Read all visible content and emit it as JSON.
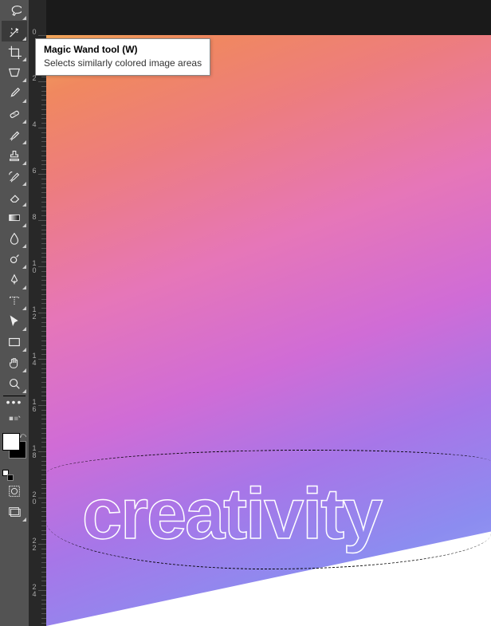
{
  "tooltip": {
    "title": "Magic Wand tool (W)",
    "description": "Selects similarly colored image areas"
  },
  "canvas": {
    "text": "creativity"
  },
  "tools": [
    {
      "name": "lasso-tool",
      "icon": "lasso"
    },
    {
      "name": "magic-wand-tool",
      "icon": "wand",
      "active": true
    },
    {
      "name": "crop-tool",
      "icon": "crop"
    },
    {
      "name": "frame-tool",
      "icon": "frame"
    },
    {
      "name": "eyedropper-tool",
      "icon": "eyedropper"
    },
    {
      "name": "healing-brush-tool",
      "icon": "bandage"
    },
    {
      "name": "brush-tool",
      "icon": "brush"
    },
    {
      "name": "clone-stamp-tool",
      "icon": "stamp"
    },
    {
      "name": "history-brush-tool",
      "icon": "history-brush"
    },
    {
      "name": "eraser-tool",
      "icon": "eraser"
    },
    {
      "name": "gradient-tool",
      "icon": "gradient"
    },
    {
      "name": "blur-tool",
      "icon": "drop"
    },
    {
      "name": "dodge-tool",
      "icon": "dodge"
    },
    {
      "name": "pen-tool",
      "icon": "pen"
    },
    {
      "name": "type-tool",
      "icon": "type"
    },
    {
      "name": "path-selection-tool",
      "icon": "arrow"
    },
    {
      "name": "rectangle-tool",
      "icon": "rect"
    },
    {
      "name": "hand-tool",
      "icon": "hand"
    },
    {
      "name": "zoom-tool",
      "icon": "zoom"
    }
  ],
  "ruler": {
    "marks": [
      "0",
      "2",
      "4",
      "6",
      "8",
      "1\n0",
      "1\n2",
      "1\n4",
      "1\n6",
      "1\n8",
      "2\n0",
      "2\n2",
      "2\n4"
    ]
  },
  "colors": {
    "foreground": "#ffffff",
    "background": "#000000"
  }
}
